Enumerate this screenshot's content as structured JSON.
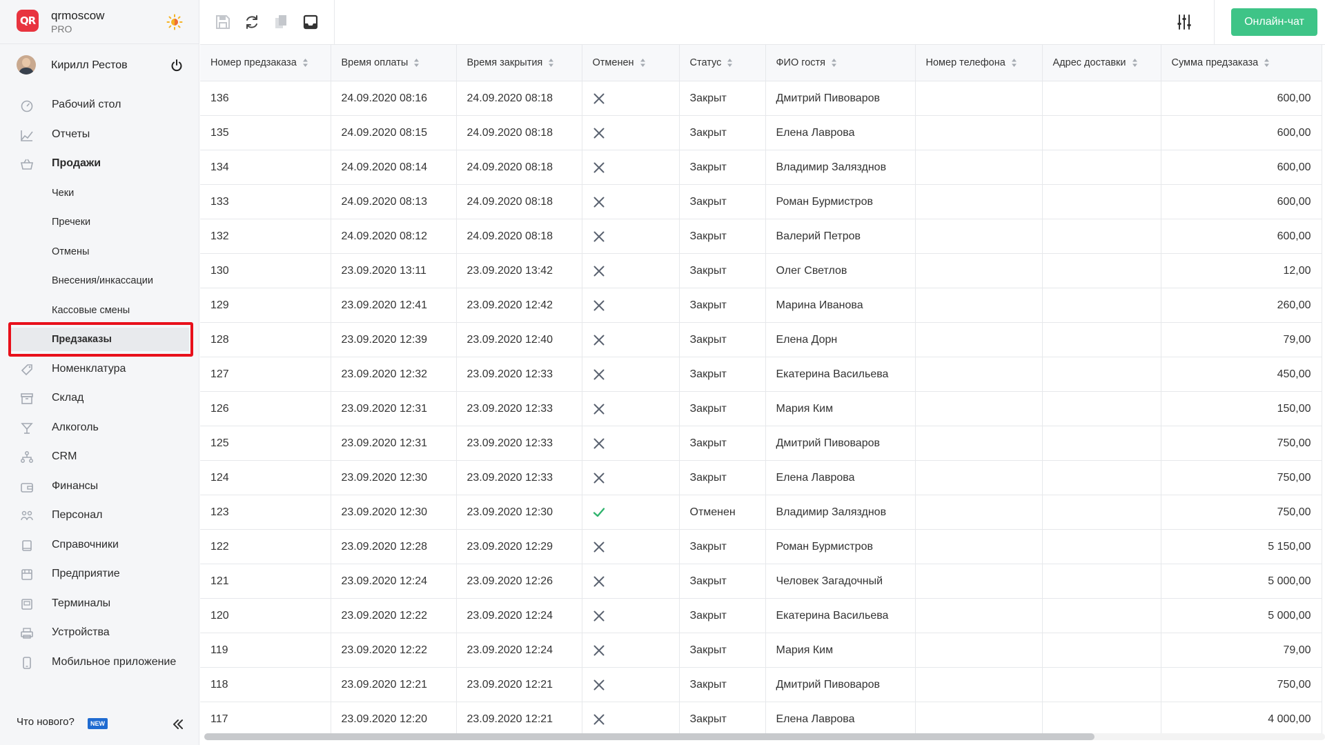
{
  "brand": {
    "name": "qrmoscow",
    "plan": "PRO",
    "logo_text": "QR"
  },
  "user": {
    "name": "Кирилл Рестов"
  },
  "nav": [
    {
      "label": "Рабочий стол",
      "icon": "dashboard-icon",
      "type": "top"
    },
    {
      "label": "Отчеты",
      "icon": "chart-icon",
      "type": "top"
    },
    {
      "label": "Продажи",
      "icon": "basket-icon",
      "type": "top",
      "bold": true
    },
    {
      "label": "Чеки",
      "type": "sub"
    },
    {
      "label": "Пречеки",
      "type": "sub"
    },
    {
      "label": "Отмены",
      "type": "sub"
    },
    {
      "label": "Внесения/инкассации",
      "type": "sub"
    },
    {
      "label": "Кассовые смены",
      "type": "sub"
    },
    {
      "label": "Предзаказы",
      "type": "sub",
      "active": true
    },
    {
      "label": "Номенклатура",
      "icon": "tag-icon",
      "type": "top"
    },
    {
      "label": "Склад",
      "icon": "archive-icon",
      "type": "top"
    },
    {
      "label": "Алкоголь",
      "icon": "cocktail-icon",
      "type": "top"
    },
    {
      "label": "CRM",
      "icon": "hierarchy-icon",
      "type": "top"
    },
    {
      "label": "Финансы",
      "icon": "wallet-icon",
      "type": "top"
    },
    {
      "label": "Персонал",
      "icon": "people-icon",
      "type": "top"
    },
    {
      "label": "Справочники",
      "icon": "book-icon",
      "type": "top"
    },
    {
      "label": "Предприятие",
      "icon": "store-icon",
      "type": "top"
    },
    {
      "label": "Терминалы",
      "icon": "terminal-icon",
      "type": "top"
    },
    {
      "label": "Устройства",
      "icon": "printer-icon",
      "type": "top"
    },
    {
      "label": "Мобильное приложение",
      "icon": "phone-icon",
      "type": "top"
    }
  ],
  "footer": {
    "whats_new": "Что нового?",
    "badge": "NEW"
  },
  "toolbar": {
    "chat_label": "Онлайн-чат"
  },
  "table": {
    "columns": [
      "Номер предзаказа",
      "Время оплаты",
      "Время закрытия",
      "Отменен",
      "Статус",
      "ФИО гостя",
      "Номер телефона",
      "Адрес доставки",
      "Сумма предзаказа"
    ],
    "rows": [
      {
        "id": "136",
        "paid": "24.09.2020 08:16",
        "closed": "24.09.2020 08:18",
        "cancelled": false,
        "status": "Закрыт",
        "guest": "Дмитрий Пивоваров",
        "phone": "",
        "address": "",
        "sum": "600,00"
      },
      {
        "id": "135",
        "paid": "24.09.2020 08:15",
        "closed": "24.09.2020 08:18",
        "cancelled": false,
        "status": "Закрыт",
        "guest": "Елена Лаврова",
        "phone": "",
        "address": "",
        "sum": "600,00"
      },
      {
        "id": "134",
        "paid": "24.09.2020 08:14",
        "closed": "24.09.2020 08:18",
        "cancelled": false,
        "status": "Закрыт",
        "guest": "Владимир Залязднов",
        "phone": "",
        "address": "",
        "sum": "600,00"
      },
      {
        "id": "133",
        "paid": "24.09.2020 08:13",
        "closed": "24.09.2020 08:18",
        "cancelled": false,
        "status": "Закрыт",
        "guest": "Роман Бурмистров",
        "phone": "",
        "address": "",
        "sum": "600,00"
      },
      {
        "id": "132",
        "paid": "24.09.2020 08:12",
        "closed": "24.09.2020 08:18",
        "cancelled": false,
        "status": "Закрыт",
        "guest": "Валерий Петров",
        "phone": "",
        "address": "",
        "sum": "600,00"
      },
      {
        "id": "130",
        "paid": "23.09.2020 13:11",
        "closed": "23.09.2020 13:42",
        "cancelled": false,
        "status": "Закрыт",
        "guest": "Олег Светлов",
        "phone": "",
        "address": "",
        "sum": "12,00"
      },
      {
        "id": "129",
        "paid": "23.09.2020 12:41",
        "closed": "23.09.2020 12:42",
        "cancelled": false,
        "status": "Закрыт",
        "guest": "Марина Иванова",
        "phone": "",
        "address": "",
        "sum": "260,00"
      },
      {
        "id": "128",
        "paid": "23.09.2020 12:39",
        "closed": "23.09.2020 12:40",
        "cancelled": false,
        "status": "Закрыт",
        "guest": "Елена Дорн",
        "phone": "",
        "address": "",
        "sum": "79,00"
      },
      {
        "id": "127",
        "paid": "23.09.2020 12:32",
        "closed": "23.09.2020 12:33",
        "cancelled": false,
        "status": "Закрыт",
        "guest": "Екатерина Васильева",
        "phone": "",
        "address": "",
        "sum": "450,00"
      },
      {
        "id": "126",
        "paid": "23.09.2020 12:31",
        "closed": "23.09.2020 12:33",
        "cancelled": false,
        "status": "Закрыт",
        "guest": "Мария Ким",
        "phone": "",
        "address": "",
        "sum": "150,00"
      },
      {
        "id": "125",
        "paid": "23.09.2020 12:31",
        "closed": "23.09.2020 12:33",
        "cancelled": false,
        "status": "Закрыт",
        "guest": "Дмитрий Пивоваров",
        "phone": "",
        "address": "",
        "sum": "750,00"
      },
      {
        "id": "124",
        "paid": "23.09.2020 12:30",
        "closed": "23.09.2020 12:33",
        "cancelled": false,
        "status": "Закрыт",
        "guest": "Елена Лаврова",
        "phone": "",
        "address": "",
        "sum": "750,00"
      },
      {
        "id": "123",
        "paid": "23.09.2020 12:30",
        "closed": "23.09.2020 12:30",
        "cancelled": true,
        "status": "Отменен",
        "guest": "Владимир Залязднов",
        "phone": "",
        "address": "",
        "sum": "750,00"
      },
      {
        "id": "122",
        "paid": "23.09.2020 12:28",
        "closed": "23.09.2020 12:29",
        "cancelled": false,
        "status": "Закрыт",
        "guest": "Роман Бурмистров",
        "phone": "",
        "address": "",
        "sum": "5 150,00"
      },
      {
        "id": "121",
        "paid": "23.09.2020 12:24",
        "closed": "23.09.2020 12:26",
        "cancelled": false,
        "status": "Закрыт",
        "guest": "Человек Загадочный",
        "phone": "",
        "address": "",
        "sum": "5 000,00"
      },
      {
        "id": "120",
        "paid": "23.09.2020 12:22",
        "closed": "23.09.2020 12:24",
        "cancelled": false,
        "status": "Закрыт",
        "guest": "Екатерина Васильева",
        "phone": "",
        "address": "",
        "sum": "5 000,00"
      },
      {
        "id": "119",
        "paid": "23.09.2020 12:22",
        "closed": "23.09.2020 12:24",
        "cancelled": false,
        "status": "Закрыт",
        "guest": "Мария Ким",
        "phone": "",
        "address": "",
        "sum": "79,00"
      },
      {
        "id": "118",
        "paid": "23.09.2020 12:21",
        "closed": "23.09.2020 12:21",
        "cancelled": false,
        "status": "Закрыт",
        "guest": "Дмитрий Пивоваров",
        "phone": "",
        "address": "",
        "sum": "750,00"
      },
      {
        "id": "117",
        "paid": "23.09.2020 12:20",
        "closed": "23.09.2020 12:21",
        "cancelled": false,
        "status": "Закрыт",
        "guest": "Елена Лаврова",
        "phone": "",
        "address": "",
        "sum": "4 000,00"
      }
    ]
  },
  "colors": {
    "accent_green": "#3ec487",
    "highlight_red": "#e8101b",
    "brand_red": "#e8343f",
    "check_green": "#2fb36d"
  }
}
